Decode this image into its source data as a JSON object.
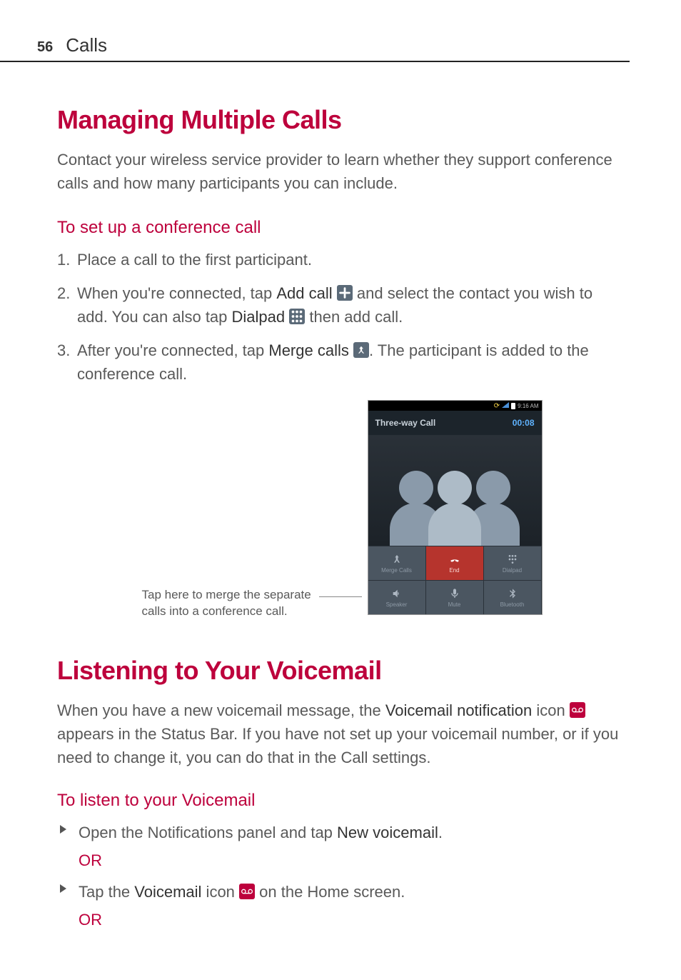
{
  "header": {
    "page_num": "56",
    "section": "Calls"
  },
  "h1a": "Managing Multiple Calls",
  "intro_a": "Contact your wireless service provider to learn whether they support conference calls and how many participants you can include.",
  "h2a": "To set up a conference call",
  "steps": {
    "s1": "Place a call to the first participant.",
    "s2a": "When you're connected, tap ",
    "s2b": "Add call",
    "s2c": " and select the contact you wish to add. You can also tap ",
    "s2d": "Dialpad",
    "s2e": " then add call.",
    "s3a": "After you're connected, tap ",
    "s3b": "Merge calls",
    "s3c": ". The participant is added to the conference call."
  },
  "callout": "Tap here to merge the separate calls into a conference call.",
  "phone": {
    "time": "9:16 AM",
    "title": "Three-way Call",
    "timer": "00:08",
    "btn_merge": "Merge Calls",
    "btn_end": "End",
    "btn_dialpad": "Dialpad",
    "btn_speaker": "Speaker",
    "btn_mute": "Mute",
    "btn_bt": "Bluetooth"
  },
  "h1b": "Listening to Your Voicemail",
  "vm_p1a": "When you have a new voicemail message, the ",
  "vm_p1b": "Voicemail notification",
  "vm_p1c": " icon ",
  "vm_p1d": " appears in the Status Bar. If you have not set up your voicemail number, or if you need to change it, you can do that in the Call settings.",
  "h2b": "To listen to your Voicemail",
  "vm_b1a": "Open the Notifications panel and tap ",
  "vm_b1b": "New voicemail",
  "vm_b1c": ".",
  "or": "OR",
  "vm_b2a": "Tap the ",
  "vm_b2b": "Voicemail",
  "vm_b2c": " icon ",
  "vm_b2d": " on the Home screen."
}
